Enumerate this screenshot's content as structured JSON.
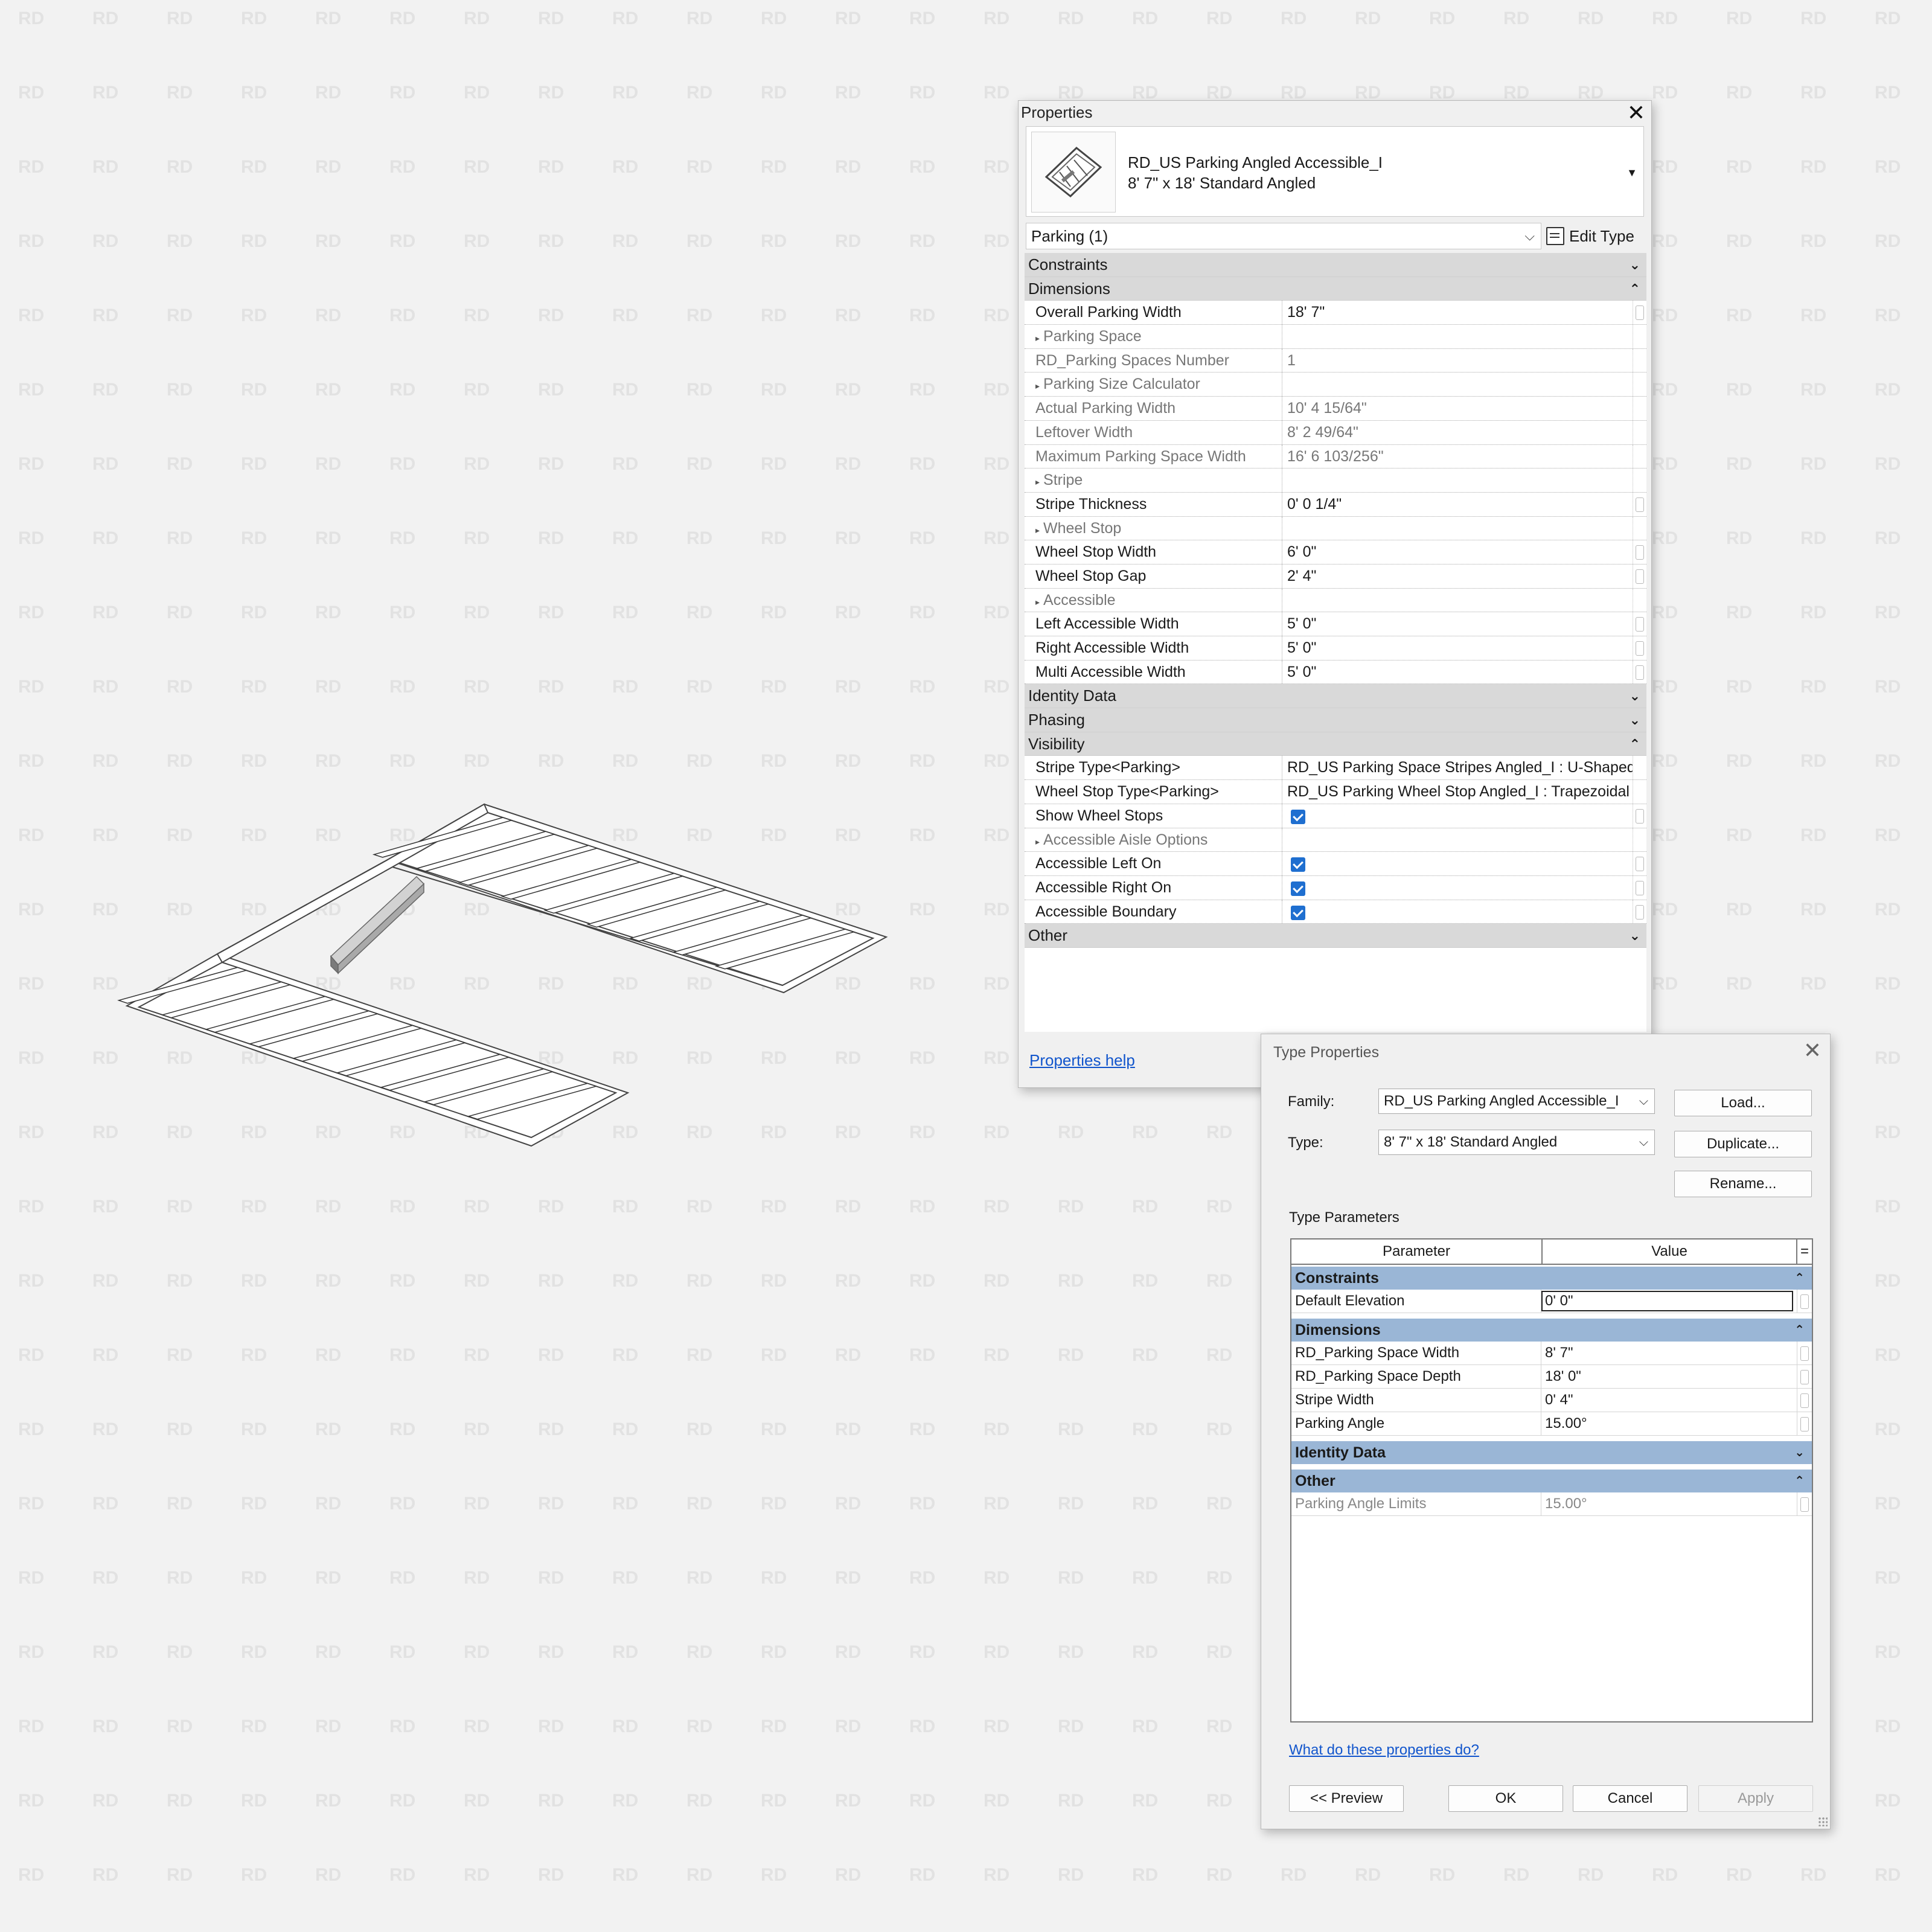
{
  "watermark": {
    "text": "RD"
  },
  "properties": {
    "title": "Properties",
    "type_name_line1": "RD_US Parking Angled Accessible_I",
    "type_name_line2": "8' 7\" x 18' Standard Angled",
    "instance_filter": "Parking (1)",
    "edit_type_label": "Edit Type",
    "help_link": "Properties help",
    "groups": [
      {
        "label": "Constraints",
        "state": "collapsed",
        "rows": []
      },
      {
        "label": "Dimensions",
        "state": "expanded",
        "rows": [
          {
            "param": "Overall Parking Width",
            "value": "18'  7\"",
            "assoc": true,
            "kind": "edit"
          },
          {
            "param": "Parking Space",
            "value": "",
            "kind": "sub"
          },
          {
            "param": "RD_Parking Spaces Number",
            "value": "1",
            "kind": "ro"
          },
          {
            "param": "Parking Size Calculator",
            "value": "",
            "kind": "sub"
          },
          {
            "param": "Actual Parking Width",
            "value": "10'  4 15/64\"",
            "kind": "ro"
          },
          {
            "param": "Leftover Width",
            "value": "8'  2 49/64\"",
            "kind": "ro"
          },
          {
            "param": "Maximum Parking Space Width",
            "value": "16'  6 103/256\"",
            "kind": "ro"
          },
          {
            "param": "Stripe",
            "value": "",
            "kind": "sub"
          },
          {
            "param": "Stripe Thickness",
            "value": "0'  0 1/4\"",
            "assoc": true,
            "kind": "edit"
          },
          {
            "param": "Wheel Stop",
            "value": "",
            "kind": "sub"
          },
          {
            "param": "Wheel Stop Width",
            "value": "6'  0\"",
            "assoc": true,
            "kind": "edit"
          },
          {
            "param": "Wheel Stop Gap",
            "value": "2'  4\"",
            "assoc": true,
            "kind": "edit"
          },
          {
            "param": "Accessible",
            "value": "",
            "kind": "sub"
          },
          {
            "param": "Left Accessible Width",
            "value": "5'  0\"",
            "assoc": true,
            "kind": "edit"
          },
          {
            "param": "Right Accessible Width",
            "value": "5'  0\"",
            "assoc": true,
            "kind": "edit"
          },
          {
            "param": "Multi Accessible Width",
            "value": "5'  0\"",
            "assoc": true,
            "kind": "edit"
          }
        ]
      },
      {
        "label": "Identity Data",
        "state": "collapsed",
        "rows": []
      },
      {
        "label": "Phasing",
        "state": "collapsed",
        "rows": []
      },
      {
        "label": "Visibility",
        "state": "expanded",
        "rows": [
          {
            "param": "Stripe Type<Parking>",
            "value": "RD_US Parking Space Stripes Angled_I : U-Shaped",
            "kind": "edit"
          },
          {
            "param": "Wheel Stop Type<Parking>",
            "value": "RD_US Parking Wheel Stop Angled_I : Trapezoidal",
            "kind": "edit"
          },
          {
            "param": "Show Wheel Stops",
            "value": "",
            "checked": true,
            "assoc": true,
            "kind": "check"
          },
          {
            "param": "Accessible Aisle Options",
            "value": "",
            "kind": "sub"
          },
          {
            "param": "Accessible Left On",
            "value": "",
            "checked": true,
            "assoc": true,
            "kind": "check"
          },
          {
            "param": "Accessible Right On",
            "value": "",
            "checked": true,
            "assoc": true,
            "kind": "check"
          },
          {
            "param": "Accessible Boundary",
            "value": "",
            "checked": true,
            "assoc": true,
            "kind": "check"
          }
        ]
      },
      {
        "label": "Other",
        "state": "collapsed",
        "rows": []
      }
    ]
  },
  "type_properties": {
    "title": "Type Properties",
    "family_label": "Family:",
    "family_value": "RD_US Parking Angled Accessible_I",
    "type_label": "Type:",
    "type_value": "8' 7\" x 18' Standard Angled",
    "load_label": "Load...",
    "duplicate_label": "Duplicate...",
    "rename_label": "Rename...",
    "section_label": "Type Parameters",
    "col_parameter": "Parameter",
    "col_value": "Value",
    "col_assoc": "=",
    "groups": [
      {
        "label": "Constraints",
        "state": "expanded",
        "rows": [
          {
            "param": "Default Elevation",
            "value": "0'  0\"",
            "editing": true
          }
        ]
      },
      {
        "label": "Dimensions",
        "state": "expanded",
        "rows": [
          {
            "param": "RD_Parking Space Width",
            "value": "8'  7\""
          },
          {
            "param": "RD_Parking Space Depth",
            "value": "18'  0\""
          },
          {
            "param": "Stripe Width",
            "value": "0'  4\""
          },
          {
            "param": "Parking Angle",
            "value": "15.00°"
          }
        ]
      },
      {
        "label": "Identity Data",
        "state": "collapsed",
        "rows": []
      },
      {
        "label": "Other",
        "state": "expanded",
        "rows": [
          {
            "param": "Parking Angle Limits",
            "value": "15.00°",
            "readonly": true
          }
        ]
      }
    ],
    "help_link": "What do these properties do?",
    "preview_label": "<< Preview",
    "ok_label": "OK",
    "cancel_label": "Cancel",
    "apply_label": "Apply"
  }
}
